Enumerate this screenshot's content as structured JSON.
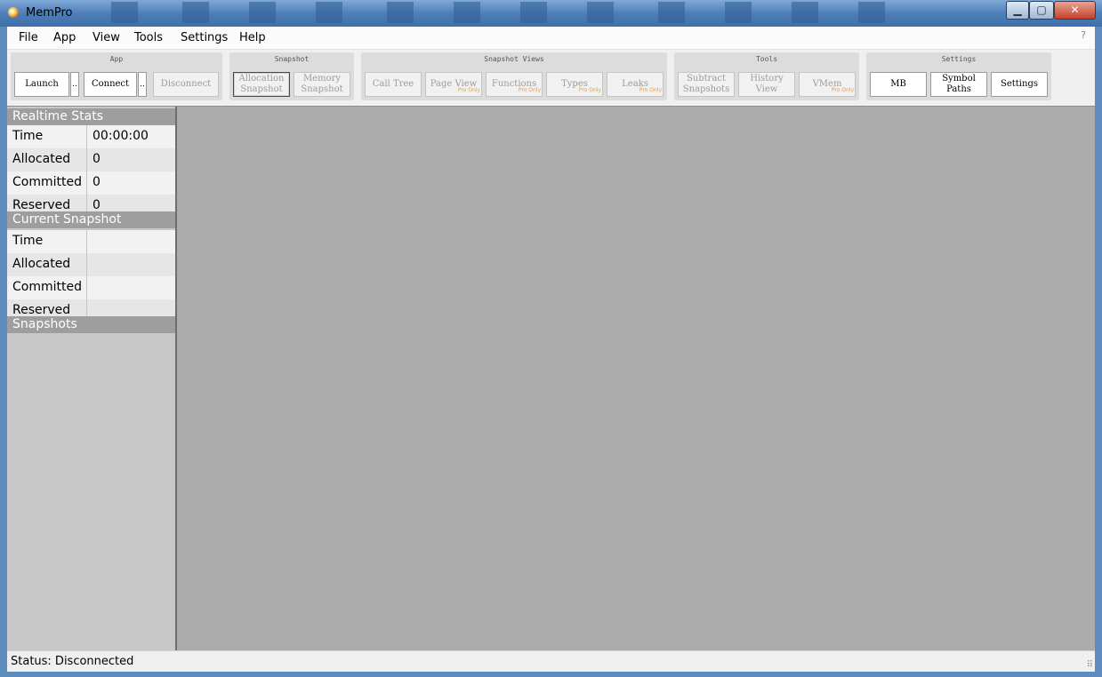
{
  "window": {
    "title": "MemPro"
  },
  "menu": [
    "File",
    "App",
    "View",
    "Tools",
    "Settings",
    "Help"
  ],
  "help_glyph": "?",
  "toolbar": {
    "app": {
      "label": "App",
      "launch": "Launch",
      "launch_more": "..",
      "connect": "Connect",
      "connect_more": "..",
      "disconnect": "Disconnect"
    },
    "snapshot": {
      "label": "Snapshot",
      "allocation": "Allocation\nSnapshot",
      "memory": "Memory\nSnapshot"
    },
    "snapshot_views": {
      "label": "Snapshot Views",
      "call_tree": "Call Tree",
      "page_view": "Page View",
      "functions": "Functions",
      "types": "Types",
      "leaks": "Leaks",
      "pro_badge": "Pro Only"
    },
    "tools": {
      "label": "Tools",
      "subtract": "Subtract\nSnapshots",
      "history": "History\nView",
      "vmem": "VMem"
    },
    "settings": {
      "label": "Settings",
      "mb": "MB",
      "symbol_paths": "Symbol\nPaths",
      "settings": "Settings"
    }
  },
  "realtime_stats": {
    "header": "Realtime Stats",
    "rows": [
      {
        "key": "Time",
        "value": "00:00:00"
      },
      {
        "key": "Allocated",
        "value": "0"
      },
      {
        "key": "Committed",
        "value": "0"
      },
      {
        "key": "Reserved",
        "value": "0"
      }
    ]
  },
  "current_snapshot": {
    "header": "Current Snapshot",
    "rows": [
      {
        "key": "Time",
        "value": ""
      },
      {
        "key": "Allocated",
        "value": ""
      },
      {
        "key": "Committed",
        "value": ""
      },
      {
        "key": "Reserved",
        "value": ""
      }
    ]
  },
  "snapshots": {
    "header": "Snapshots"
  },
  "status": {
    "text": "Status: Disconnected"
  }
}
